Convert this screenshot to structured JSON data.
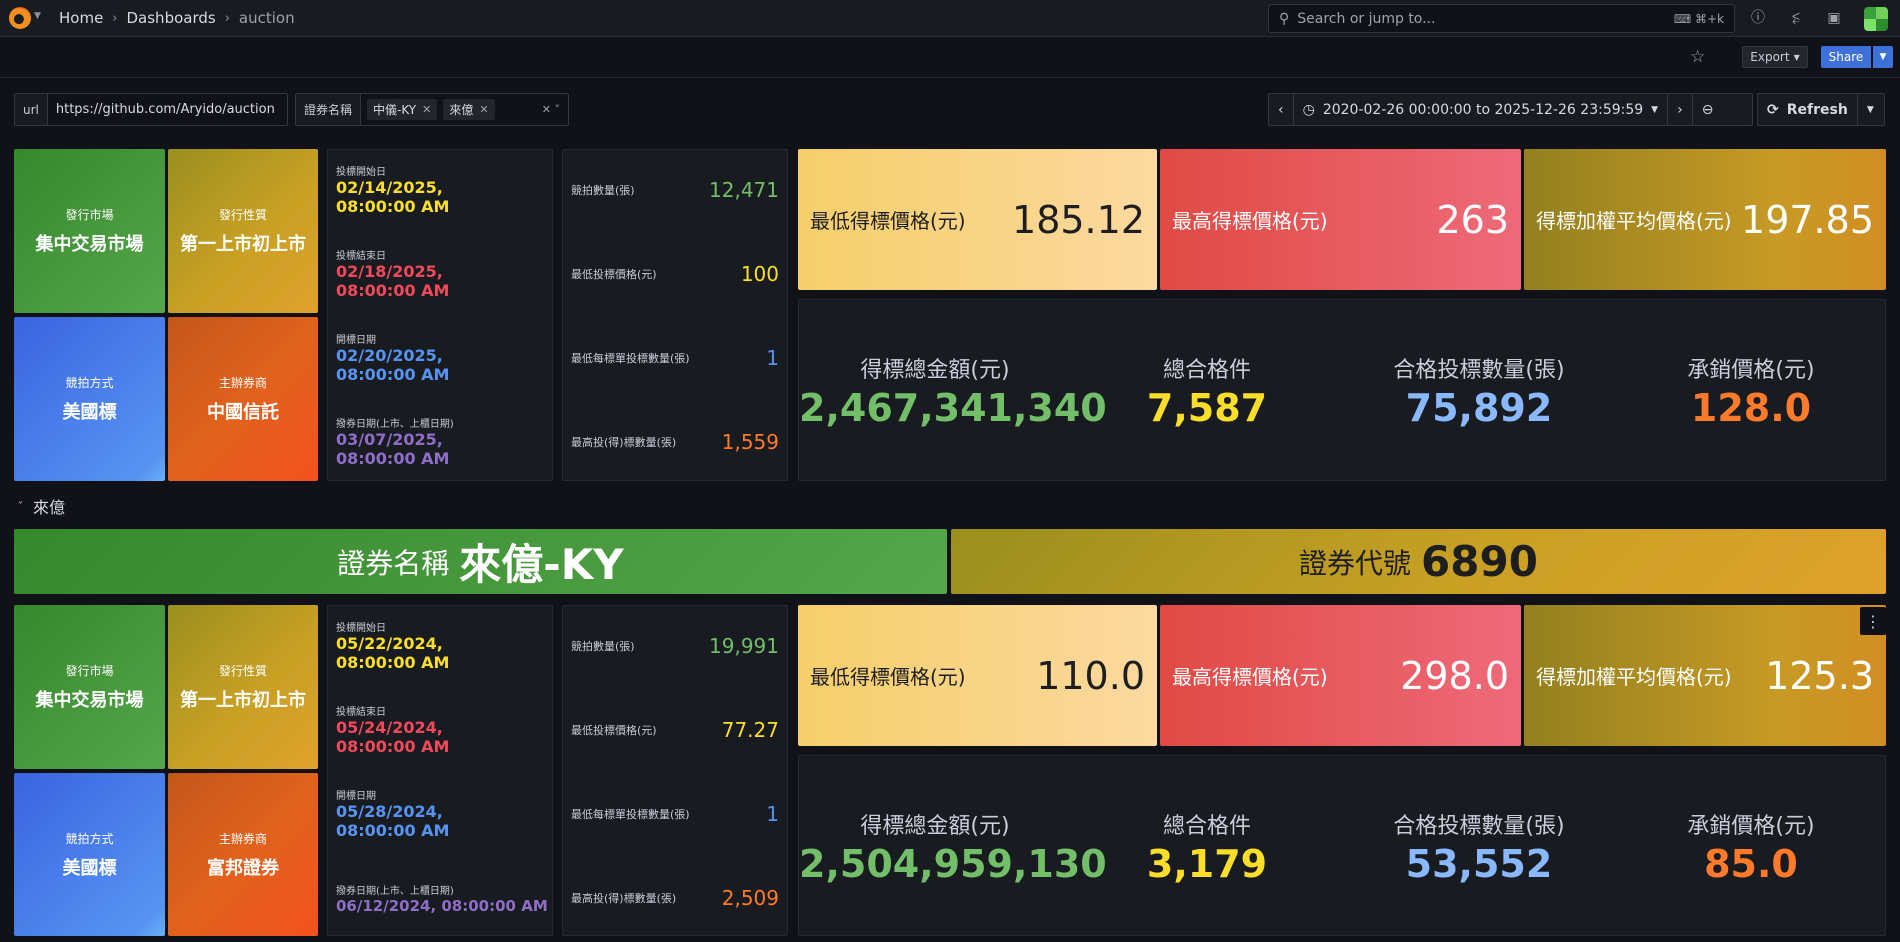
{
  "nav": {
    "crumbs": [
      "Home",
      "Dashboards",
      "auction"
    ],
    "search_placeholder": "Search or jump to...",
    "shortcut": "⌘+k",
    "export_label": "Export",
    "share_label": "Share"
  },
  "vars": {
    "url_label": "url",
    "url_value": "https://github.com/Aryido/auction",
    "name_label": "證券名稱",
    "chips": [
      "中儀-KY",
      "來億"
    ]
  },
  "time": {
    "range": "2020-02-26 00:00:00 to 2025-12-26 23:59:59",
    "refresh_label": "Refresh"
  },
  "colors": {
    "green": "#73bf69",
    "yellow": "#fade2a",
    "red": "#f2495c",
    "blue": "#5794f2",
    "purple": "#8f6ec9",
    "orange": "#ff7a2a"
  },
  "sections": [
    {
      "tiles": [
        {
          "title": "發行市場",
          "value": "集中交易市場"
        },
        {
          "title": "發行性質",
          "value": "第一上市初上市"
        },
        {
          "title": "競拍方式",
          "value": "美國標"
        },
        {
          "title": "主辦券商",
          "value": "中國信託"
        }
      ],
      "dates": [
        {
          "label": "投標開始日",
          "value": "02/14/2025, 08:00:00 AM"
        },
        {
          "label": "投標結束日",
          "value": "02/18/2025, 08:00:00 AM"
        },
        {
          "label": "開標日期",
          "value": "02/20/2025, 08:00:00 AM"
        },
        {
          "label": "撥券日期(上市、上櫃日期)",
          "value": "03/07/2025, 08:00:00 AM"
        }
      ],
      "counts": [
        {
          "label": "競拍數量(張)",
          "value": "12,471"
        },
        {
          "label": "最低投標價格(元)",
          "value": "100"
        },
        {
          "label": "最低每標單投標數量(張)",
          "value": "1"
        },
        {
          "label": "最高投(得)標數量(張)",
          "value": "1,559"
        }
      ],
      "prices": [
        {
          "label": "最低得標價格(元)",
          "value": "185.12"
        },
        {
          "label": "最高得標價格(元)",
          "value": "263"
        },
        {
          "label": "得標加權平均價格(元)",
          "value": "197.85"
        }
      ],
      "stats": [
        {
          "label": "得標總金額(元)",
          "value": "2,467,341,340"
        },
        {
          "label": "總合格件",
          "value": "7,587"
        },
        {
          "label": "合格投標數量(張)",
          "value": "75,892"
        },
        {
          "label": "承銷價格(元)",
          "value": "128.0"
        }
      ]
    },
    {
      "row_title": "來億",
      "banner": {
        "name_label": "證券名稱",
        "name_value": "來億-KY",
        "code_label": "證券代號",
        "code_value": "6890"
      },
      "tiles": [
        {
          "title": "發行市場",
          "value": "集中交易市場"
        },
        {
          "title": "發行性質",
          "value": "第一上市初上市"
        },
        {
          "title": "競拍方式",
          "value": "美國標"
        },
        {
          "title": "主辦券商",
          "value": "富邦證券"
        }
      ],
      "dates": [
        {
          "label": "投標開始日",
          "value": "05/22/2024, 08:00:00 AM"
        },
        {
          "label": "投標結束日",
          "value": "05/24/2024, 08:00:00 AM"
        },
        {
          "label": "開標日期",
          "value": "05/28/2024, 08:00:00 AM"
        },
        {
          "label": "撥券日期(上市、上櫃日期)",
          "value": "06/12/2024, 08:00:00 AM"
        }
      ],
      "counts": [
        {
          "label": "競拍數量(張)",
          "value": "19,991"
        },
        {
          "label": "最低投標價格(元)",
          "value": "77.27"
        },
        {
          "label": "最低每標單投標數量(張)",
          "value": "1"
        },
        {
          "label": "最高投(得)標數量(張)",
          "value": "2,509"
        }
      ],
      "prices": [
        {
          "label": "最低得標價格(元)",
          "value": "110.0"
        },
        {
          "label": "最高得標價格(元)",
          "value": "298.0"
        },
        {
          "label": "得標加權平均價格(元)",
          "value": "125.3"
        }
      ],
      "stats": [
        {
          "label": "得標總金額(元)",
          "value": "2,504,959,130"
        },
        {
          "label": "總合格件",
          "value": "3,179"
        },
        {
          "label": "合格投標數量(張)",
          "value": "53,552"
        },
        {
          "label": "承銷價格(元)",
          "value": "85.0"
        }
      ]
    }
  ]
}
